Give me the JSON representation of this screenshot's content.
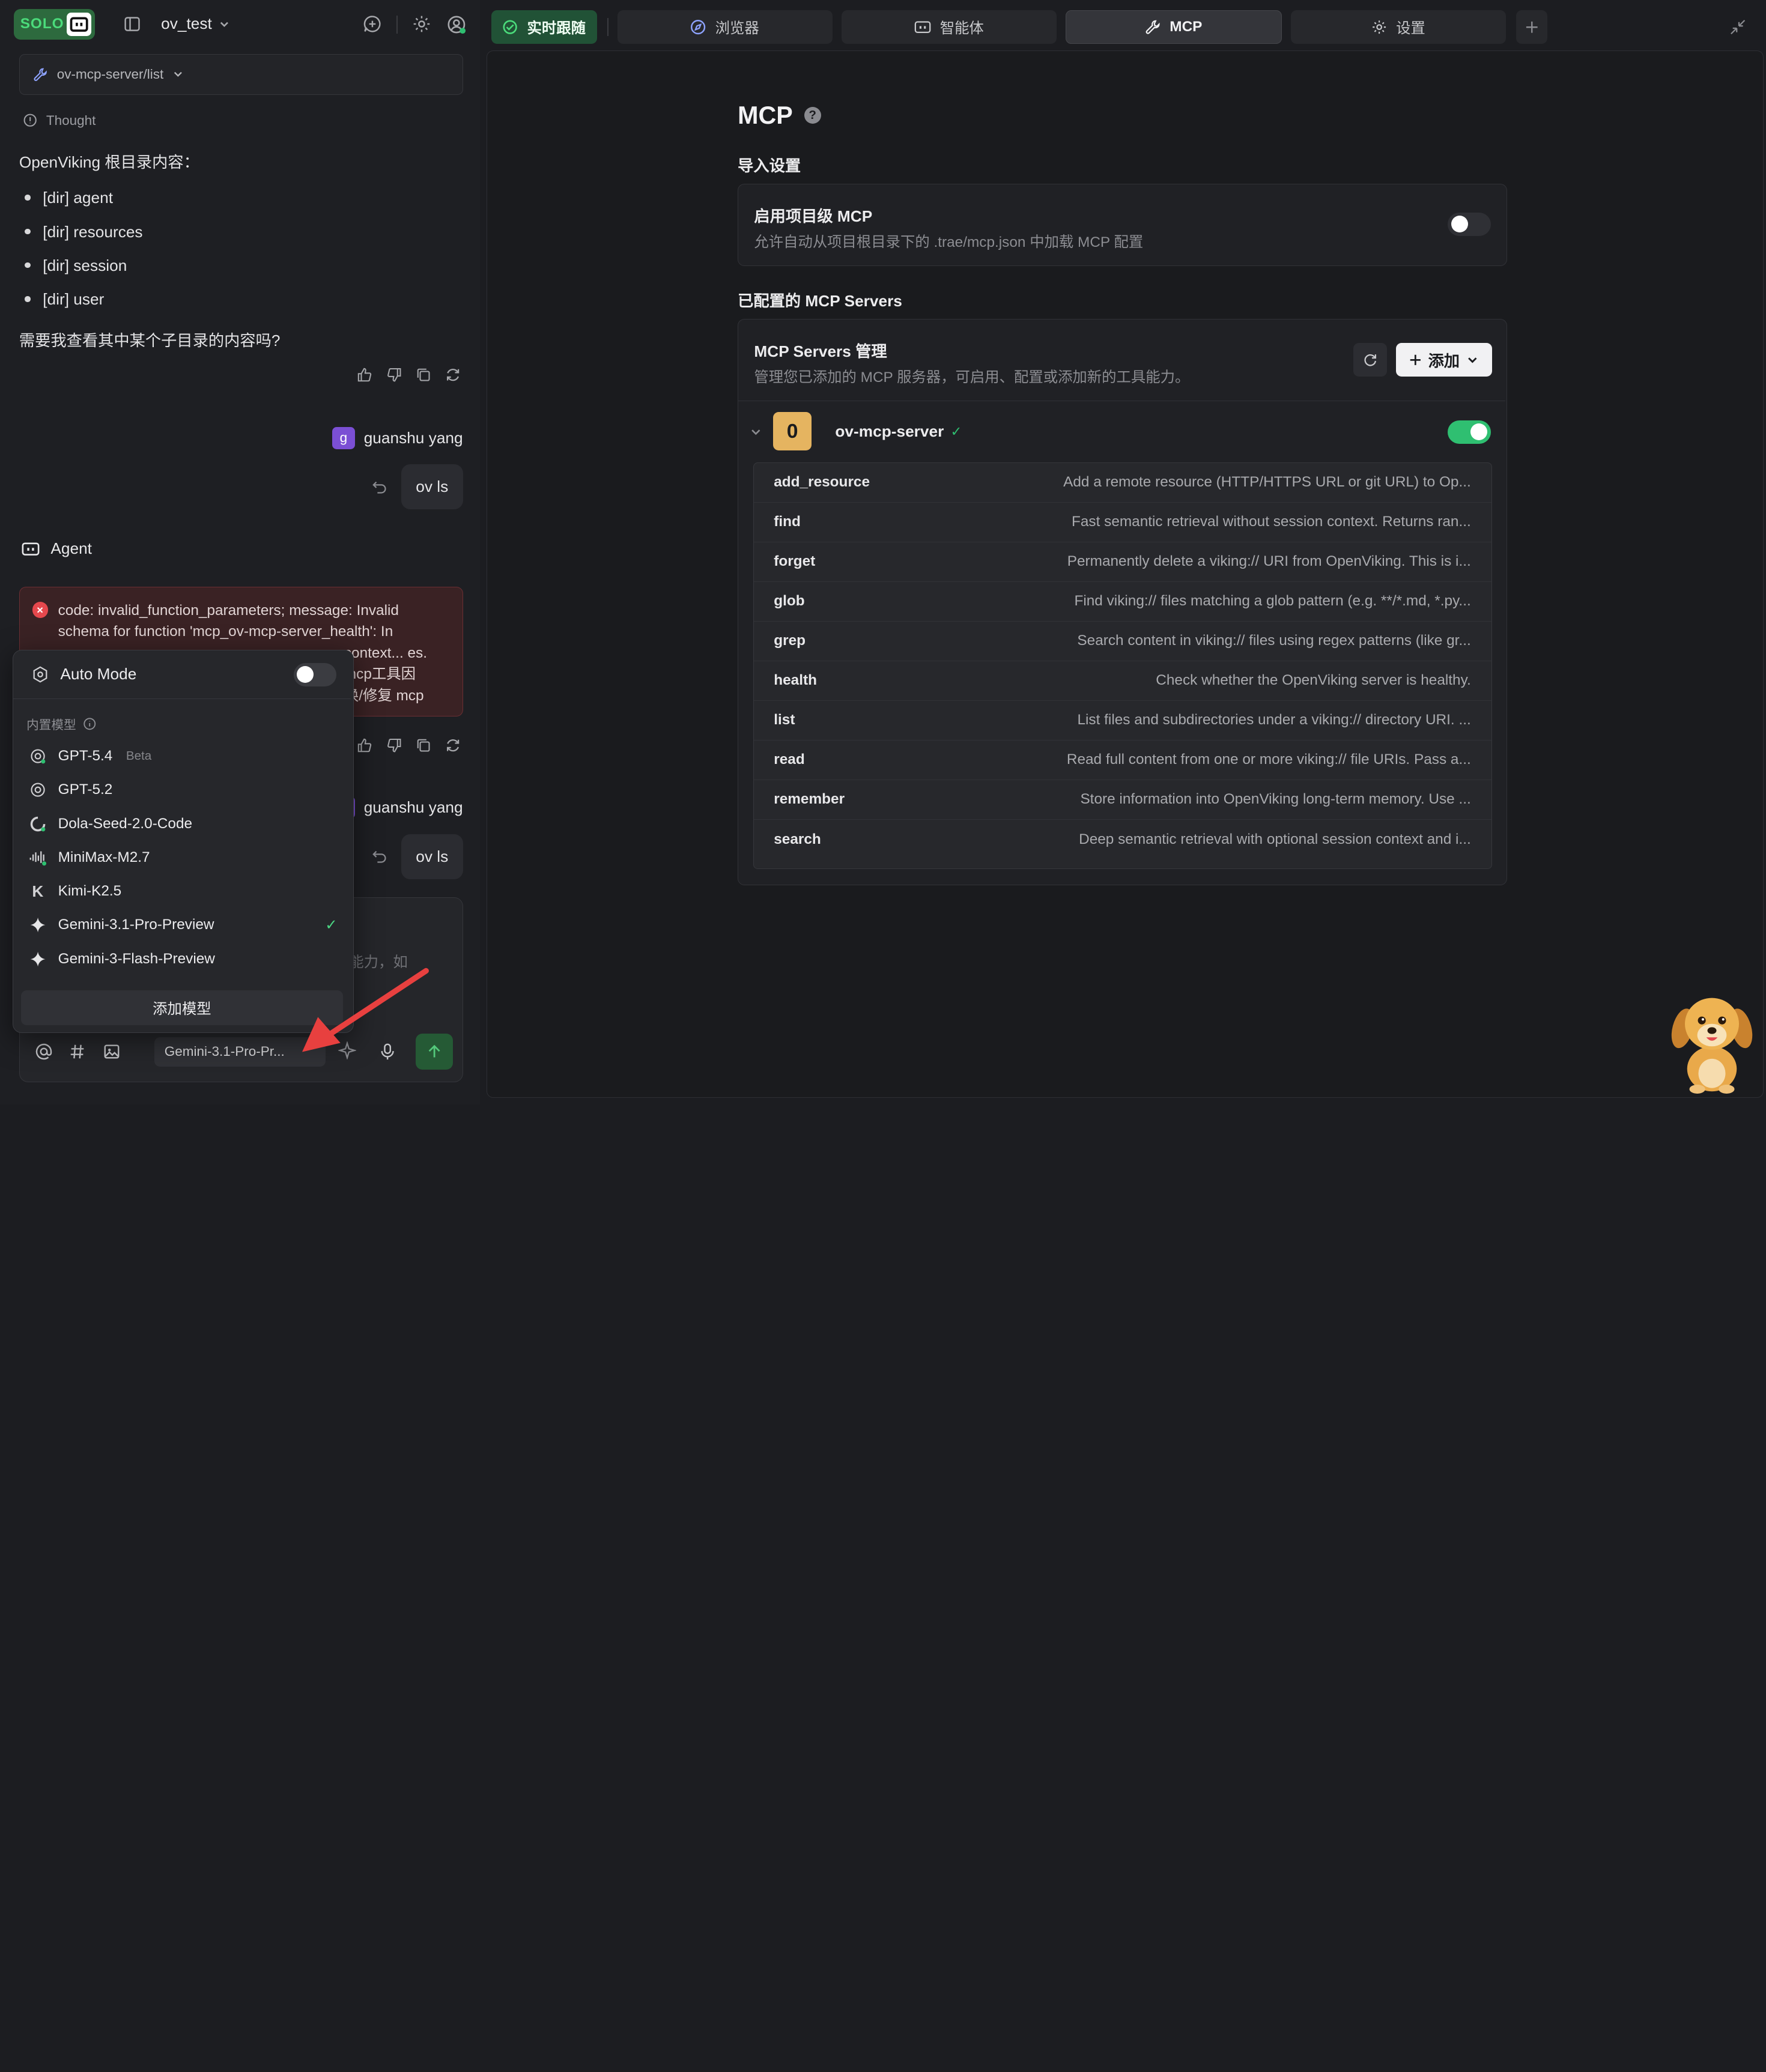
{
  "colors": {
    "accent_green": "#2fbf71",
    "error_red": "#e5484d",
    "server_icon_bg": "#e5b460"
  },
  "topbar": {
    "brand": "SOLO",
    "project": "ov_test"
  },
  "breadcrumb": {
    "path": "ov-mcp-server/list"
  },
  "chat": {
    "thought_label": "Thought",
    "intro": "OpenViking 根目录内容：",
    "items": [
      "[dir] agent",
      "[dir] resources",
      "[dir] session",
      "[dir] user"
    ],
    "question": "需要我查看其中某个子目录的内容吗?",
    "user_name": "guanshu yang",
    "user_initial": "g",
    "user_message_1": "ov ls",
    "user_message_2": "ov ls",
    "agent_label": "Agent",
    "error_line1": "code: invalid_function_parameters; message: Invalid",
    "error_line2": "schema for function 'mcp_ov-mcp-server_health': In",
    "error_line3": "context... es. mcp工具因",
    "error_line4": "换/修复 mcp",
    "input_placeholder": "能力，如"
  },
  "model_menu": {
    "auto_mode": "Auto Mode",
    "section_label": "内置模型",
    "models": [
      {
        "name": "GPT-5.4",
        "badge": "Beta",
        "icon": "openai-icon"
      },
      {
        "name": "GPT-5.2",
        "badge": "",
        "icon": "openai-icon"
      },
      {
        "name": "Dola-Seed-2.0-Code",
        "badge": "",
        "icon": "seed-icon"
      },
      {
        "name": "MiniMax-M2.7",
        "badge": "",
        "icon": "minimax-icon"
      },
      {
        "name": "Kimi-K2.5",
        "badge": "",
        "icon": "kimi-icon"
      },
      {
        "name": "Gemini-3.1-Pro-Preview",
        "badge": "",
        "icon": "gemini-icon",
        "selected": true
      },
      {
        "name": "Gemini-3-Flash-Preview",
        "badge": "",
        "icon": "gemini-icon"
      }
    ],
    "add_model": "添加模型"
  },
  "composer": {
    "model_selected": "Gemini-3.1-Pro-Pr..."
  },
  "tabs": [
    {
      "label": "实时跟随",
      "icon": "live-icon"
    },
    {
      "label": "浏览器",
      "icon": "compass-icon"
    },
    {
      "label": "智能体",
      "icon": "bot-icon"
    },
    {
      "label": "MCP",
      "icon": "wrench-icon",
      "active": true
    },
    {
      "label": "设置",
      "icon": "gear-icon"
    }
  ],
  "mcp": {
    "title": "MCP",
    "import_heading": "导入设置",
    "project_mcp_title": "启用项目级 MCP",
    "project_mcp_desc": "允许自动从项目根目录下的 .trae/mcp.json 中加载 MCP 配置",
    "project_mcp_enabled": false,
    "configured_heading": "已配置的 MCP Servers",
    "servers_title": "MCP Servers 管理",
    "servers_desc": "管理您已添加的 MCP 服务器，可启用、配置或添加新的工具能力。",
    "add_label": "添加",
    "server": {
      "icon_letter": "0",
      "name": "ov-mcp-server",
      "enabled": true
    },
    "tools": [
      {
        "name": "add_resource",
        "desc": "Add a remote resource (HTTP/HTTPS URL or git URL) to Op..."
      },
      {
        "name": "find",
        "desc": "Fast semantic retrieval without session context. Returns ran..."
      },
      {
        "name": "forget",
        "desc": "Permanently delete a viking:// URI from OpenViking. This is i..."
      },
      {
        "name": "glob",
        "desc": "Find viking:// files matching a glob pattern (e.g. **/*.md, *.py..."
      },
      {
        "name": "grep",
        "desc": "Search content in viking:// files using regex patterns (like gr..."
      },
      {
        "name": "health",
        "desc": "Check whether the OpenViking server is healthy."
      },
      {
        "name": "list",
        "desc": "List files and subdirectories under a viking:// directory URI. ..."
      },
      {
        "name": "read",
        "desc": "Read full content from one or more viking:// file URIs. Pass a..."
      },
      {
        "name": "remember",
        "desc": "Store information into OpenViking long-term memory. Use ..."
      },
      {
        "name": "search",
        "desc": "Deep semantic retrieval with optional session context and i..."
      }
    ]
  }
}
